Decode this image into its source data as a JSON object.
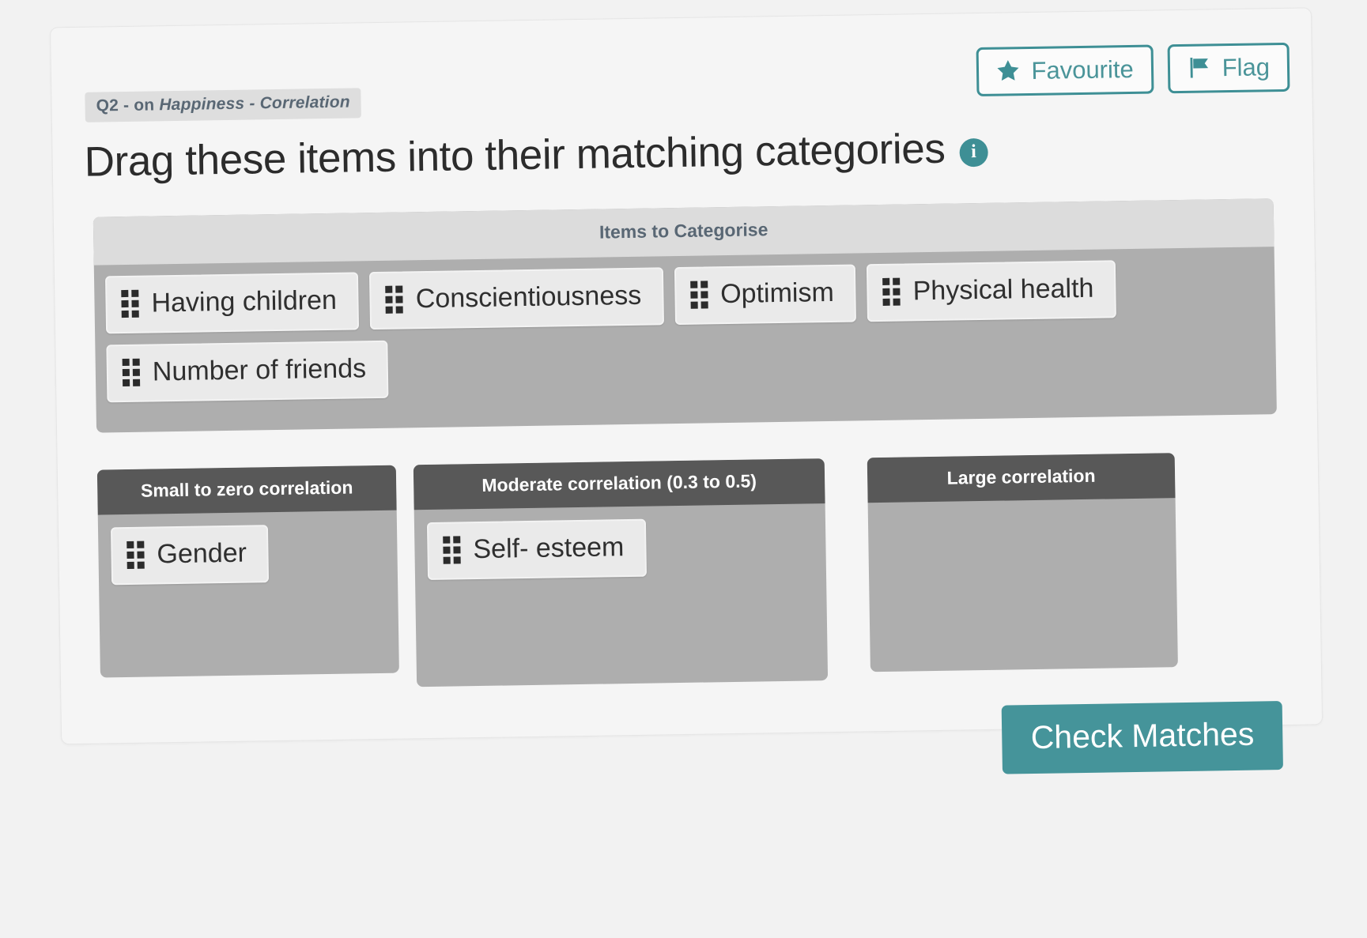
{
  "question": {
    "tag_prefix": "Q2 - on ",
    "tag_topic": "Happiness - Correlation",
    "title": "Drag these items into their matching categories",
    "info_icon": "info-icon"
  },
  "header_buttons": {
    "favourite": {
      "label": "Favourite",
      "icon": "star-icon"
    },
    "flag": {
      "label": "Flag",
      "icon": "flag-icon"
    }
  },
  "pool": {
    "heading": "Items to Categorise",
    "items": [
      {
        "label": "Having children"
      },
      {
        "label": "Conscientiousness"
      },
      {
        "label": "Optimism"
      },
      {
        "label": "Physical health"
      },
      {
        "label": "Number of friends"
      }
    ]
  },
  "categories": [
    {
      "heading": "Small to zero correlation",
      "items": [
        {
          "label": "Gender"
        }
      ]
    },
    {
      "heading": "Moderate correlation (0.3 to 0.5)",
      "items": [
        {
          "label": "Self- esteem"
        }
      ]
    },
    {
      "heading": "Large correlation",
      "items": []
    }
  ],
  "footer": {
    "check_label": "Check Matches"
  },
  "colors": {
    "accent_teal": "#3e8f95",
    "check_button": "#45949a",
    "zone_header": "#585858",
    "zone_body": "#aeaeae",
    "pool_header": "#dcdcdc",
    "chip": "#eaeaea",
    "page_background": "#f2f2f2"
  }
}
